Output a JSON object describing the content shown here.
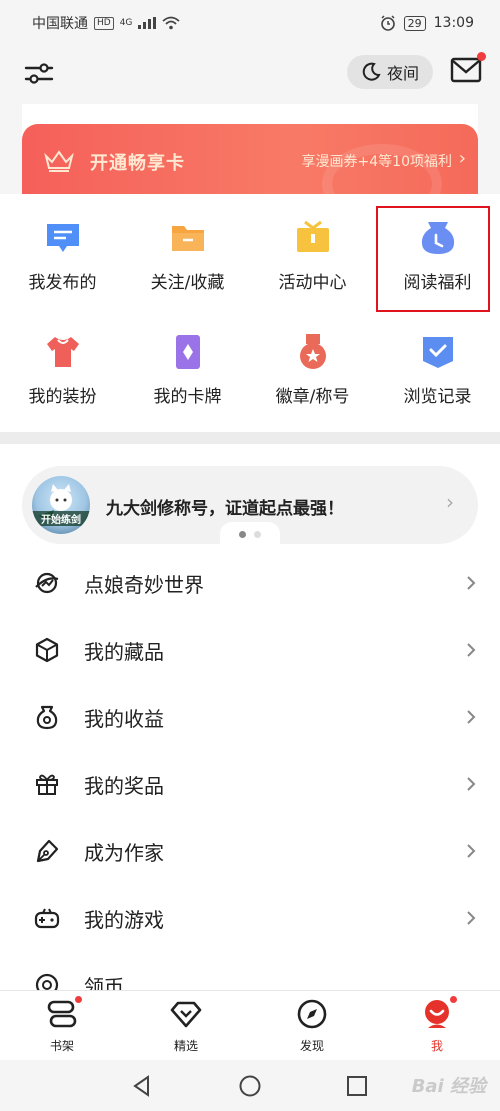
{
  "status_bar": {
    "carrier": "中国联通",
    "hd_badge": "HD",
    "network": "4G",
    "battery": "29",
    "time": "13:09"
  },
  "topbar": {
    "night_label": "夜间"
  },
  "vip": {
    "title": "开通畅享卡",
    "desc": "享漫画券+4等10项福利",
    "arrow": "›"
  },
  "grid": [
    {
      "label": "我发布的",
      "icon": "message-icon",
      "color": "#4f8ff7"
    },
    {
      "label": "关注/收藏",
      "icon": "folder-icon",
      "color": "#f7a541"
    },
    {
      "label": "活动中心",
      "icon": "gift-box-icon",
      "color": "#f7c23e"
    },
    {
      "label": "阅读福利",
      "icon": "clock-bag-icon",
      "color": "#6b8ef2"
    },
    {
      "label": "我的装扮",
      "icon": "tshirt-icon",
      "color": "#f0605a"
    },
    {
      "label": "我的卡牌",
      "icon": "card-icon",
      "color": "#9a73e8"
    },
    {
      "label": "徽章/称号",
      "icon": "medal-icon",
      "color": "#ea6a5a"
    },
    {
      "label": "浏览记录",
      "icon": "history-icon",
      "color": "#5c8df0"
    }
  ],
  "banner": {
    "avatar_tag": "开始练剑",
    "text": "九大剑修称号，证道起点最强！"
  },
  "list": [
    {
      "label": "点娘奇妙世界",
      "icon": "planet-icon"
    },
    {
      "label": "我的藏品",
      "icon": "cube-icon"
    },
    {
      "label": "我的收益",
      "icon": "money-bag-icon"
    },
    {
      "label": "我的奖品",
      "icon": "gift-icon"
    },
    {
      "label": "成为作家",
      "icon": "pen-icon"
    },
    {
      "label": "我的游戏",
      "icon": "gamepad-icon"
    },
    {
      "label": "领币",
      "icon": "coin-icon"
    }
  ],
  "bottom_nav": [
    {
      "label": "书架",
      "icon": "bookshelf-icon"
    },
    {
      "label": "精选",
      "icon": "diamond-icon"
    },
    {
      "label": "发现",
      "icon": "compass-icon"
    },
    {
      "label": "我",
      "icon": "profile-icon"
    }
  ],
  "watermark": "Bai 经验",
  "accent_color": "#e5332b"
}
